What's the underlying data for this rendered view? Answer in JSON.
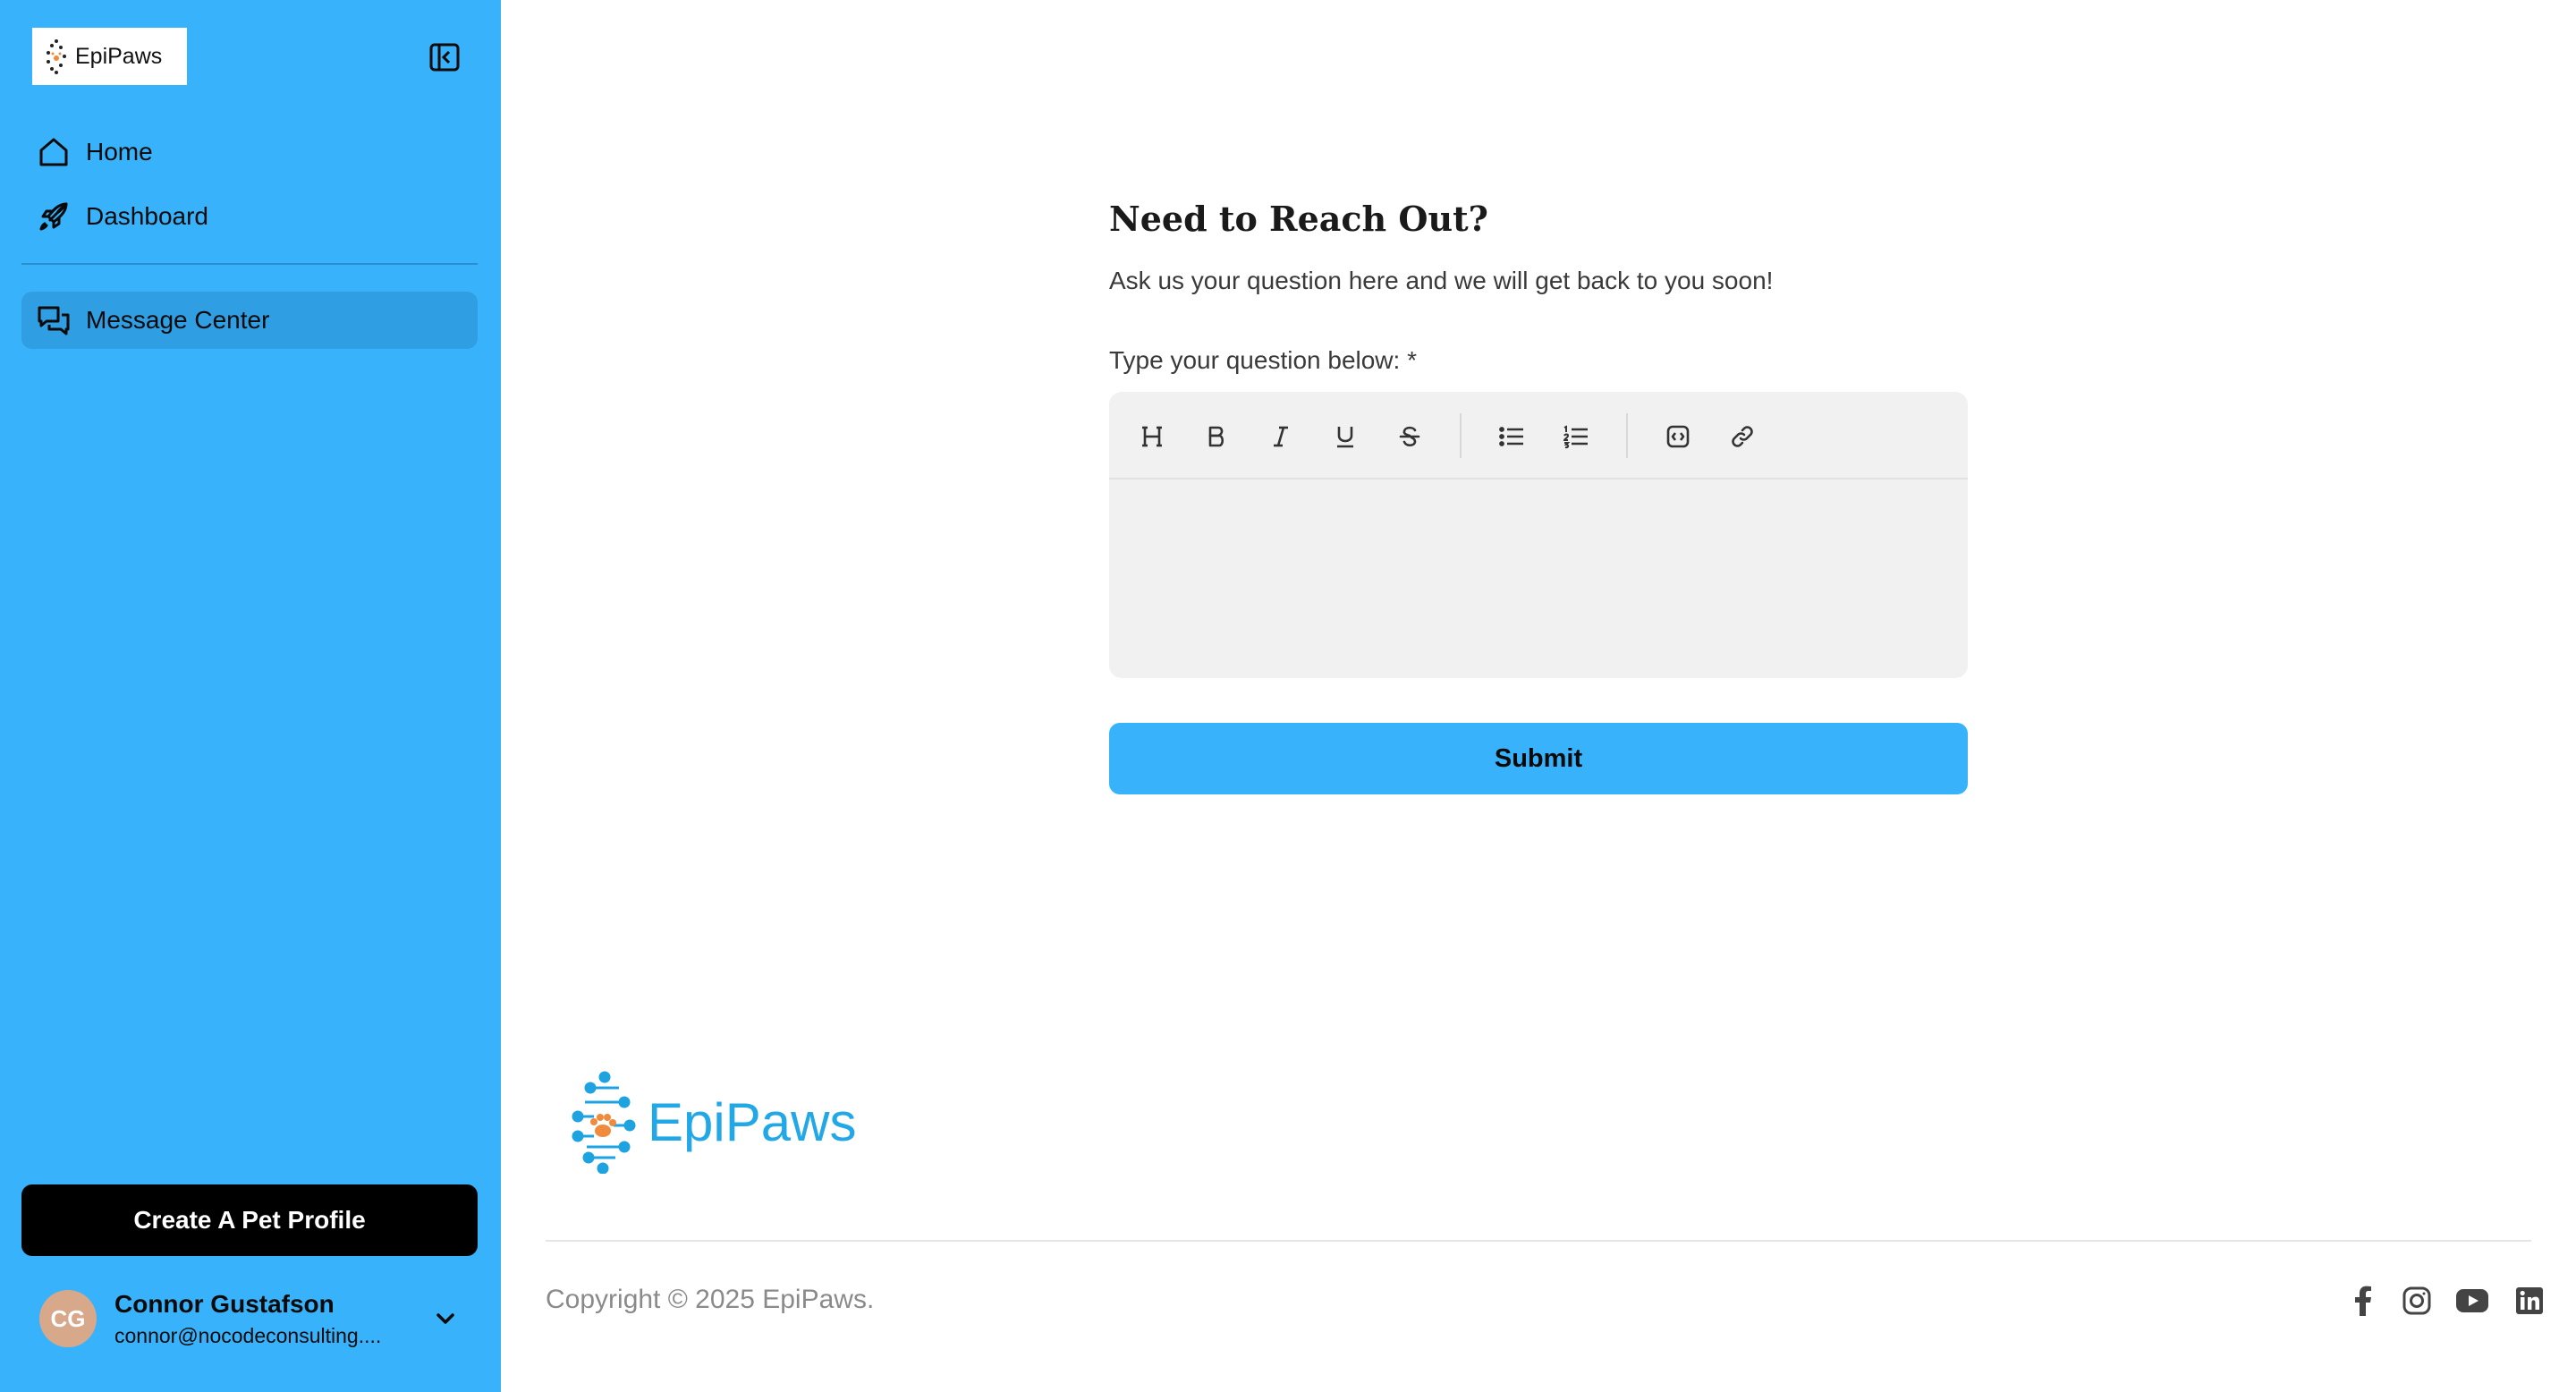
{
  "sidebar": {
    "logo_text": "EpiPaws",
    "collapse_icon": "sidebar-collapse-icon",
    "nav": [
      {
        "label": "Home",
        "icon": "home-icon"
      },
      {
        "label": "Dashboard",
        "icon": "rocket-icon"
      },
      {
        "label": "Message Center",
        "icon": "chat-bubbles-icon",
        "active": true
      }
    ],
    "cta_label": "Create A Pet Profile",
    "user": {
      "initials": "CG",
      "name": "Connor Gustafson",
      "email": "connor@nocodeconsulting...."
    }
  },
  "main": {
    "title": "Need to Reach Out?",
    "subtitle": "Ask us your question here and we will get back to you soon!",
    "field_label": "Type your question below: *",
    "editor_value": "",
    "toolbar": [
      "heading-icon",
      "bold-icon",
      "italic-icon",
      "underline-icon",
      "strikethrough-icon",
      "bullet-list-icon",
      "numbered-list-icon",
      "code-block-icon",
      "link-icon"
    ],
    "submit_label": "Submit"
  },
  "footer": {
    "logo_text": "EpiPaws",
    "copyright": "Copyright © 2025 EpiPaws.",
    "social": [
      "facebook-icon",
      "instagram-icon",
      "youtube-icon",
      "linkedin-icon"
    ]
  },
  "colors": {
    "sidebar_bg": "#38b3fb",
    "active_nav": "#2f9ee3",
    "primary_button": "#38b3fb",
    "cta_button": "#000000",
    "brand_text": "#22a8e6",
    "paw_orange": "#f08a3c"
  }
}
